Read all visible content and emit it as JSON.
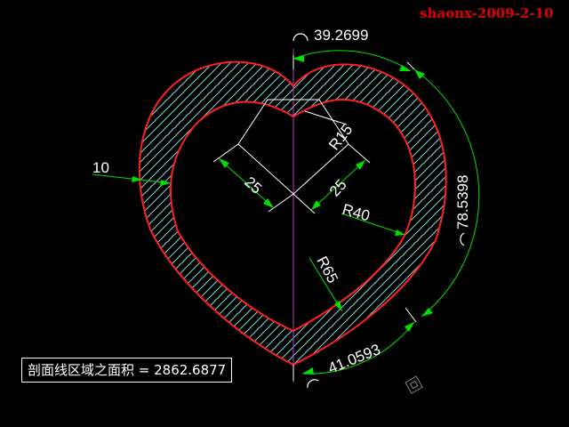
{
  "watermark": "shaonx-2009-2-10",
  "area_label": "剖面线区域之面积 = 2862.6877",
  "colors": {
    "background": "#000000",
    "outline": "#ff2020",
    "hatch": "#7fd8d8",
    "dimension": "#00e000",
    "construction": "#ffffff",
    "centerline": "#c040c0",
    "text": "#ffffff"
  },
  "dimensions": {
    "arc_top": "39.2699",
    "arc_right": "78.5398",
    "arc_bottom": "41.0593",
    "thickness": "10",
    "square_left": "25",
    "square_right": "25",
    "r_small": "R15",
    "r_medium": "R40",
    "r_large": "R65"
  },
  "icons": {
    "arc_symbol": "arc-length-icon",
    "ucs": "ucs-icon"
  }
}
